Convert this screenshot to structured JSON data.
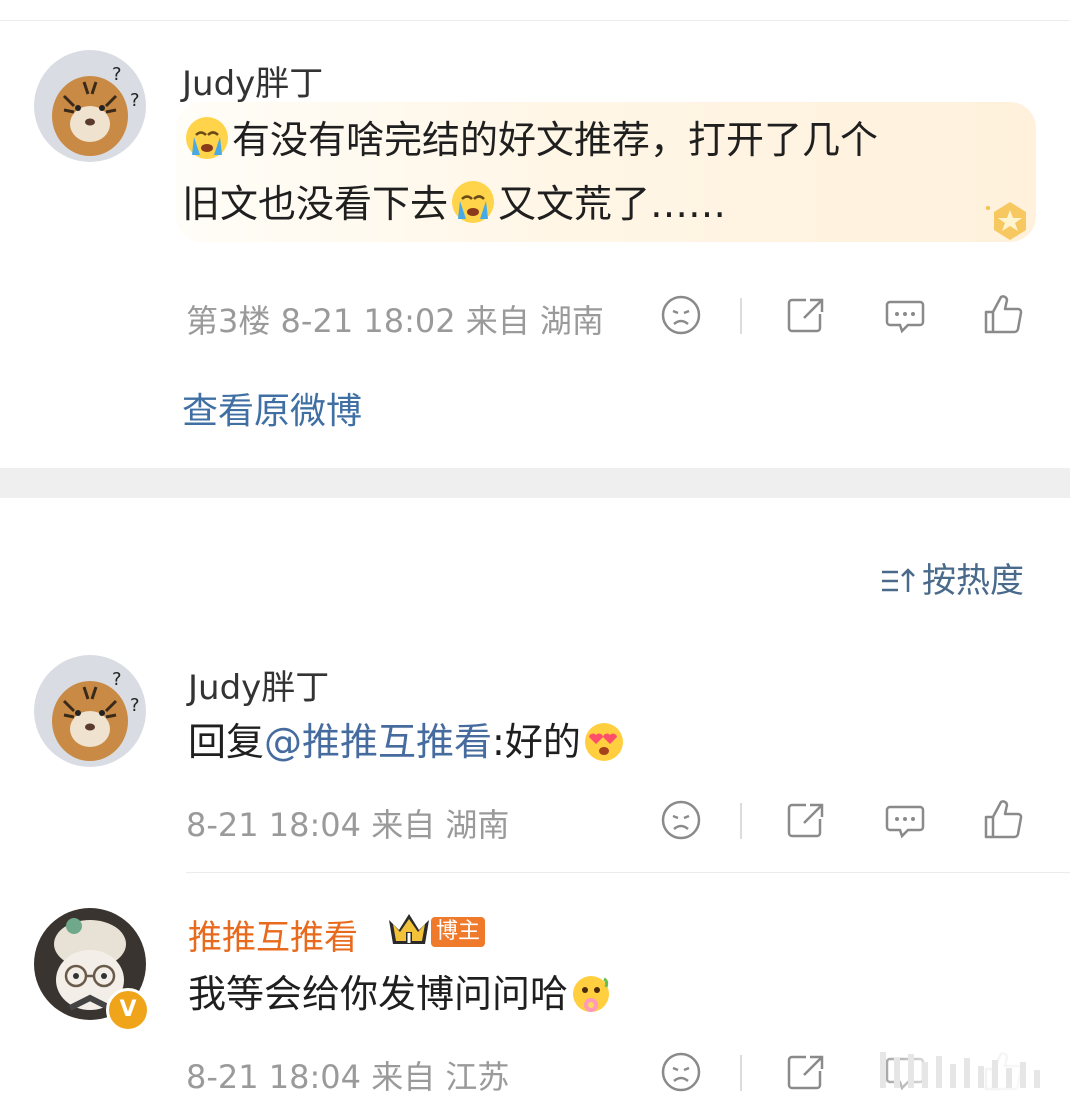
{
  "post": {
    "author": "Judy胖丁",
    "text_part1": "有没有啥完结的好文推荐，打开了几个",
    "text_part2": "旧文也没看下去",
    "text_part3": "又文荒了……",
    "floor": "第3楼",
    "time": "8-21 18:02",
    "source": "来自 湖南",
    "view_original": "查看原微博",
    "emoji_names": [
      "crying-face-emoji",
      "crying-face-emoji"
    ]
  },
  "sort": {
    "label": "按热度",
    "icon": "sort-icon"
  },
  "comments": [
    {
      "author": "Judy胖丁",
      "reply_prefix": "回复",
      "mention": "@推推互推看",
      "text": ":好的",
      "emoji": "heart-eyes-emoji",
      "time": "8-21 18:04",
      "source": "来自 湖南"
    },
    {
      "author": "推推互推看",
      "badge": "博主",
      "verified": "V",
      "text": "我等会给你发博问问哈",
      "emoji": "flower-emoji",
      "time": "8-21 18:04",
      "source": "来自 江苏"
    }
  ],
  "actions": [
    "dislike-icon",
    "share-icon",
    "comment-icon",
    "like-icon"
  ],
  "colors": {
    "link": "#466b9e",
    "vip_name": "#e86a1c",
    "meta_gray": "#9a9a9a",
    "separator": "#efefef"
  }
}
